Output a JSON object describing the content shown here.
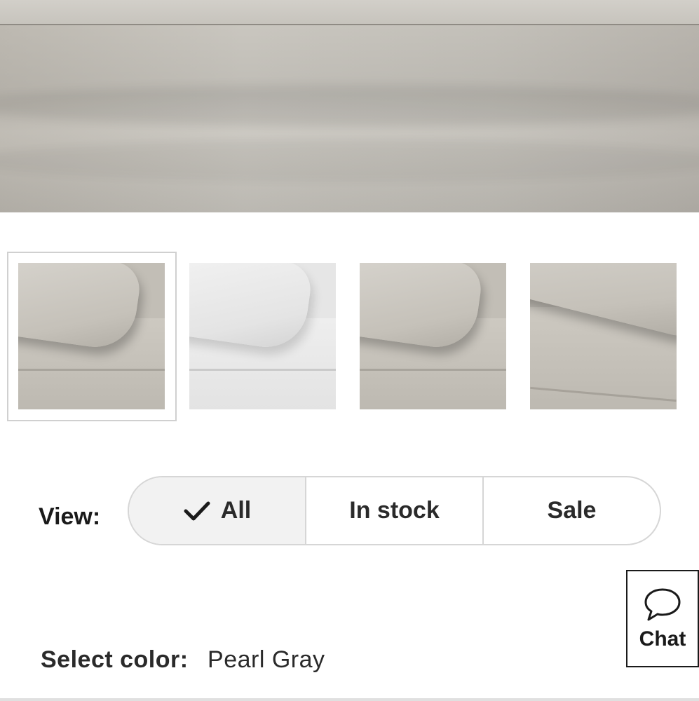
{
  "filter": {
    "label": "View:",
    "options": [
      {
        "label": "All",
        "selected": true
      },
      {
        "label": "In stock",
        "selected": false
      },
      {
        "label": "Sale",
        "selected": false
      }
    ]
  },
  "chat": {
    "label": "Chat",
    "icon": "chat-bubble-icon"
  },
  "color": {
    "label": "Select color:",
    "value": "Pearl Gray"
  },
  "thumbnails": [
    {
      "color_hint": "gray",
      "selected": true
    },
    {
      "color_hint": "white",
      "selected": false
    },
    {
      "color_hint": "gray",
      "selected": false
    },
    {
      "color_hint": "gray",
      "selected": false
    }
  ],
  "colors": {
    "border": "#d6d6d6",
    "active_segment": "#f2f2f2",
    "text": "#222222"
  }
}
